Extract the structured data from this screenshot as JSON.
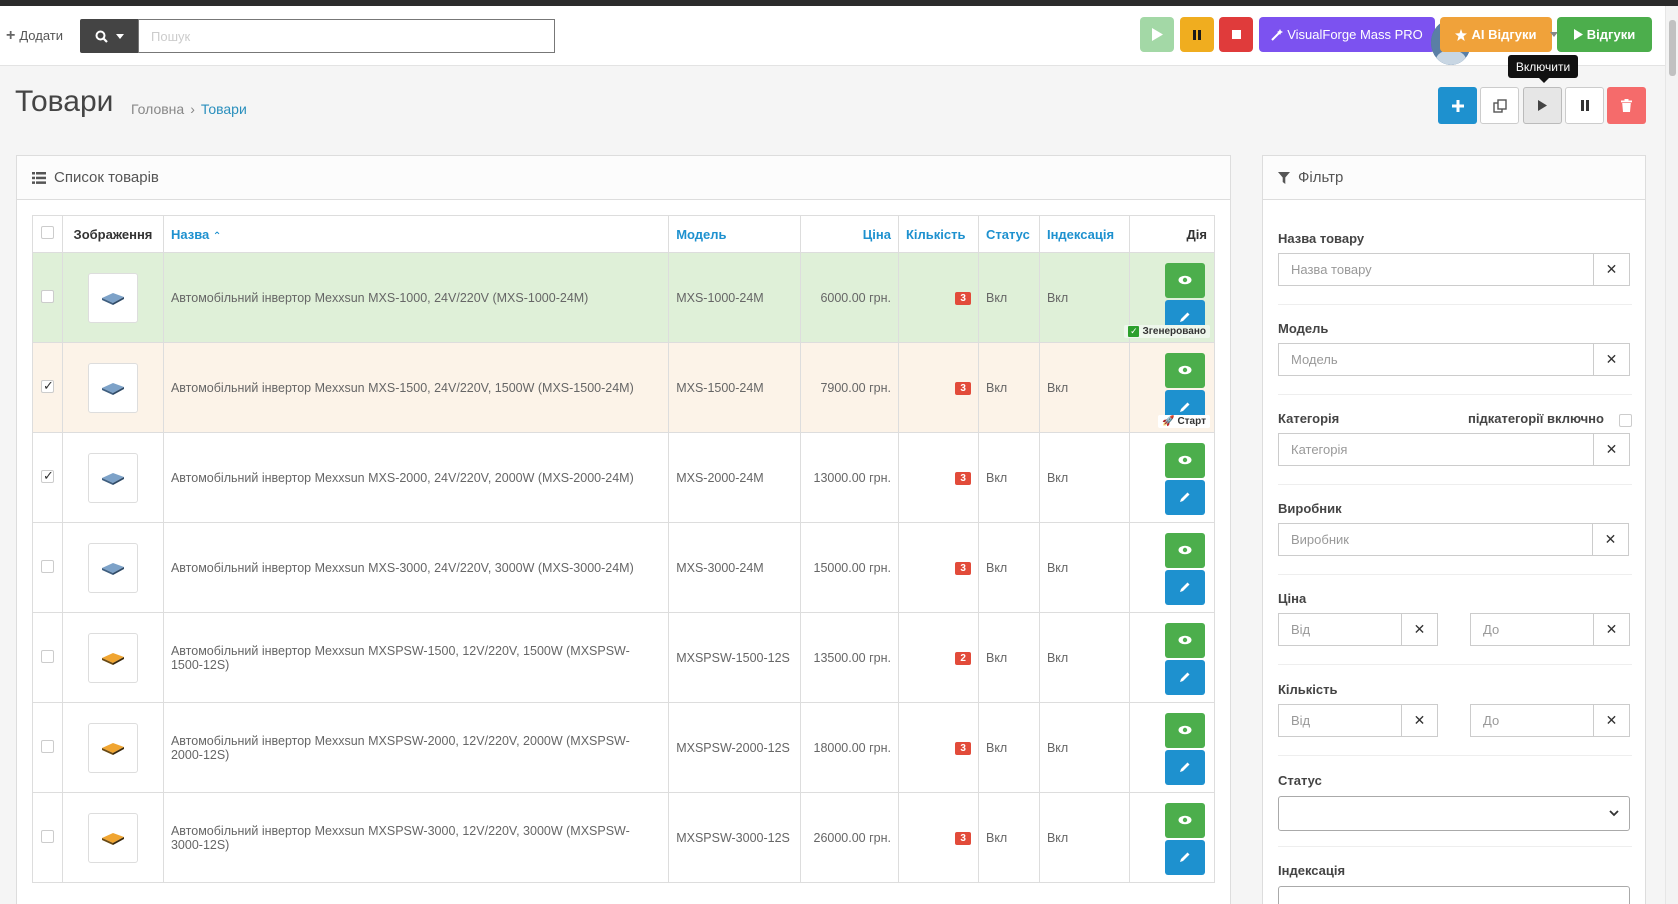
{
  "header": {
    "add_label": "Додати",
    "search_placeholder": "Пошук",
    "visualforge_label": "VisualForge Mass PRO",
    "ai_reviews_label": "AI Відгуки",
    "reviews_label": "Відгуки"
  },
  "page": {
    "title": "Товари",
    "breadcrumb": [
      "Головна",
      "Товари"
    ],
    "tooltip": "Включити"
  },
  "list": {
    "title": "Список товарів",
    "columns": {
      "image": "Зображення",
      "name": "Назва",
      "model": "Модель",
      "price": "Ціна",
      "quantity": "Кількість",
      "status": "Статус",
      "indexing": "Індексація",
      "action": "Дія"
    },
    "rows": [
      {
        "checked": false,
        "name": "Автомобільний інвертор Mexxsun MXS-1000, 24V/220V (MXS-1000-24M)",
        "model": "MXS-1000-24M",
        "price": "6000.00 грн.",
        "qty": "3",
        "status": "Вкл",
        "indexing": "Вкл",
        "tag": "Згенеровано"
      },
      {
        "checked": true,
        "name": "Автомобільний інвертор Mexxsun MXS-1500, 24V/220V, 1500W (MXS-1500-24M)",
        "model": "MXS-1500-24M",
        "price": "7900.00 грн.",
        "qty": "3",
        "status": "Вкл",
        "indexing": "Вкл",
        "tag": "Старт"
      },
      {
        "checked": true,
        "name": "Автомобільний інвертор Mexxsun MXS-2000, 24V/220V, 2000W (MXS-2000-24M)",
        "model": "MXS-2000-24M",
        "price": "13000.00 грн.",
        "qty": "3",
        "status": "Вкл",
        "indexing": "Вкл"
      },
      {
        "checked": false,
        "name": "Автомобільний інвертор Mexxsun MXS-3000, 24V/220V, 3000W (MXS-3000-24M)",
        "model": "MXS-3000-24M",
        "price": "15000.00 грн.",
        "qty": "3",
        "status": "Вкл",
        "indexing": "Вкл"
      },
      {
        "checked": false,
        "name": "Автомобільний інвертор Mexxsun MXSPSW-1500, 12V/220V, 1500W (MXSPSW-1500-12S)",
        "model": "MXSPSW-1500-12S",
        "price": "13500.00 грн.",
        "qty": "2",
        "status": "Вкл",
        "indexing": "Вкл"
      },
      {
        "checked": false,
        "name": "Автомобільний інвертор Mexxsun MXSPSW-2000, 12V/220V, 2000W (MXSPSW-2000-12S)",
        "model": "MXSPSW-2000-12S",
        "price": "18000.00 грн.",
        "qty": "3",
        "status": "Вкл",
        "indexing": "Вкл"
      },
      {
        "checked": false,
        "name": "Автомобільний інвертор Mexxsun MXSPSW-3000, 12V/220V, 3000W (MXSPSW-3000-12S)",
        "model": "MXSPSW-3000-12S",
        "price": "26000.00 грн.",
        "qty": "3",
        "status": "Вкл",
        "indexing": "Вкл"
      }
    ]
  },
  "filter": {
    "title": "Фільтр",
    "name_label": "Назва товару",
    "name_placeholder": "Назва товару",
    "model_label": "Модель",
    "model_placeholder": "Модель",
    "category_label": "Категорія",
    "subcategories_label": "підкатегорії включно",
    "category_placeholder": "Категорія",
    "manufacturer_label": "Виробник",
    "manufacturer_placeholder": "Виробник",
    "price_label": "Ціна",
    "from_placeholder": "Від",
    "to_placeholder": "До",
    "quantity_label": "Кількість",
    "status_label": "Статус",
    "indexing_label": "Індексація"
  },
  "colors": {
    "primary": "#1e91cf",
    "success": "#4cae4c",
    "danger": "#e03b3b",
    "warning": "#f0ad1f",
    "purple": "#7c52f0"
  }
}
